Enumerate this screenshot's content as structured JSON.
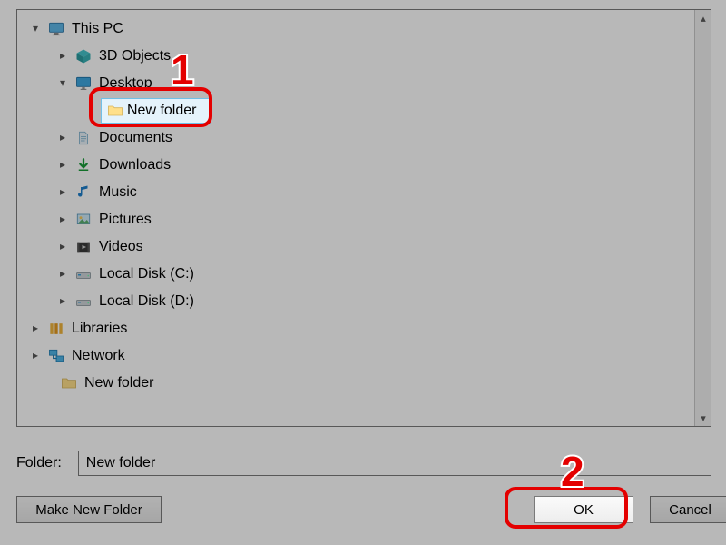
{
  "tree": {
    "root": {
      "exp": "▾",
      "label": "This PC"
    },
    "objects3d": {
      "exp": "▸",
      "label": "3D Objects"
    },
    "desktop": {
      "exp": "▾",
      "label": "Desktop"
    },
    "newfolder_sel": {
      "exp": "",
      "label": "New folder"
    },
    "documents": {
      "exp": "▸",
      "label": "Documents"
    },
    "downloads": {
      "exp": "▸",
      "label": "Downloads"
    },
    "music": {
      "exp": "▸",
      "label": "Music"
    },
    "pictures": {
      "exp": "▸",
      "label": "Pictures"
    },
    "videos": {
      "exp": "▸",
      "label": "Videos"
    },
    "disk_c": {
      "exp": "▸",
      "label": "Local Disk (C:)"
    },
    "disk_d": {
      "exp": "▸",
      "label": "Local Disk (D:)"
    },
    "libraries": {
      "exp": "▸",
      "label": "Libraries"
    },
    "network": {
      "exp": "▸",
      "label": "Network"
    },
    "newfolder_root": {
      "exp": "",
      "label": "New folder"
    }
  },
  "folder_field": {
    "label": "Folder:",
    "value": "New folder"
  },
  "buttons": {
    "make_new": "Make New Folder",
    "ok": "OK",
    "cancel": "Cancel"
  },
  "callouts": {
    "n1": "1",
    "n2": "2"
  }
}
